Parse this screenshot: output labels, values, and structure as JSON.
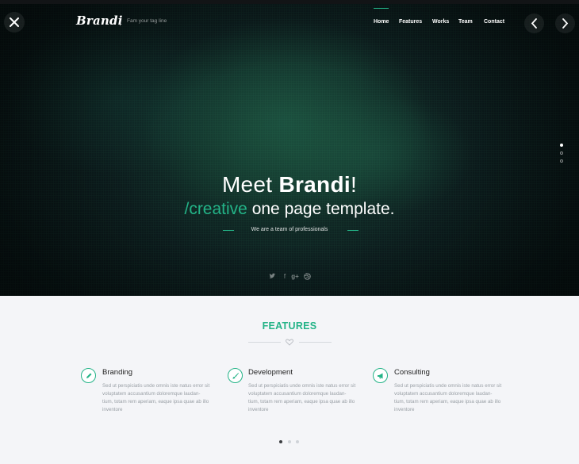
{
  "brand": {
    "logo": "Brandi",
    "tagline": "Fam your tag line"
  },
  "nav": {
    "items": [
      {
        "label": "Home",
        "active": true
      },
      {
        "label": "Features",
        "active": false
      },
      {
        "label": "Works",
        "active": false
      },
      {
        "label": "Team",
        "active": false
      },
      {
        "label": "Contact",
        "active": false
      }
    ]
  },
  "hero": {
    "title_prefix": "Meet ",
    "title_bold": "Brandi",
    "title_suffix": "!",
    "subtitle_accent": "/creative",
    "subtitle_rest": " one page template.",
    "tagline": "We are a team of professionals",
    "social_icons": [
      "twitter-icon",
      "facebook-icon",
      "google-plus-icon",
      "dribbble-icon"
    ],
    "slide_count": 3,
    "active_slide": 1
  },
  "features": {
    "title": "FEATURES",
    "items": [
      {
        "icon": "pencil-icon",
        "title": "Branding",
        "text_lines": [
          "Sed ut perspiciatis unde omnis iste natus error sit",
          "voluptatem accusantium doloremque laudan-",
          "tium, totam rem aperiam, eaque ipsa quae ab illo",
          "inventore"
        ]
      },
      {
        "icon": "brush-icon",
        "title": "Development",
        "text_lines": [
          "Sed ut perspiciatis unde omnis iste natus error sit",
          "voluptatem accusantium doloremque laudan-",
          "tium, totam rem aperiam, eaque ipsa quae ab illo",
          "inventore"
        ]
      },
      {
        "icon": "megaphone-icon",
        "title": "Consulting",
        "text_lines": [
          "Sed ut perspiciatis unde omnis iste natus error sit",
          "voluptatem accusantium doloremque laudan-",
          "tium, totam rem aperiam, eaque ipsa quae ab illo",
          "inventore"
        ]
      }
    ],
    "page_count": 3,
    "active_page": 1
  },
  "colors": {
    "accent": "#23b387",
    "section_bg": "#f4f5f8"
  }
}
